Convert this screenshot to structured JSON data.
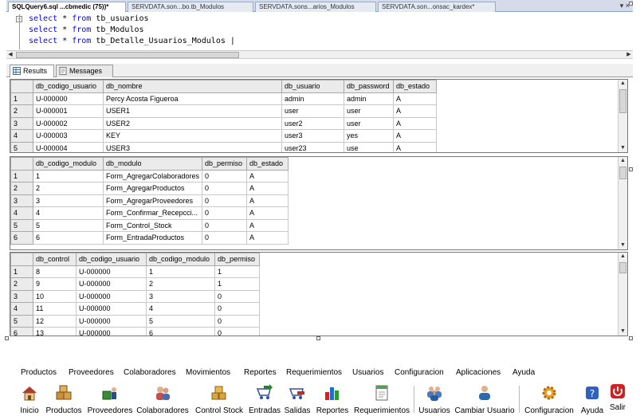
{
  "tabs": [
    {
      "label": "SQLQuery6.sql ...cbmedic (75))*",
      "active": true
    },
    {
      "label": "SERVDATA.son...bo.tb_Modulos",
      "active": false
    },
    {
      "label": "SERVDATA.sons...arios_Modulos",
      "active": false
    },
    {
      "label": "SERVDATA.son...onsac_kardex*",
      "active": false
    }
  ],
  "tab_menu": "▾ ×",
  "editor": {
    "lines": [
      {
        "kw1": "select",
        "mid": " * ",
        "kw2": "from",
        "rest": " tb_usuarios"
      },
      {
        "kw1": "select",
        "mid": " * ",
        "kw2": "from",
        "rest": " tb_Modulos"
      },
      {
        "kw1": "select",
        "mid": " * ",
        "kw2": "from",
        "rest": " tb_Detalle_Usuarios_Modulos |"
      }
    ]
  },
  "results_tabs": {
    "results": "Results",
    "messages": "Messages"
  },
  "grid1": {
    "columns": [
      "db_codigo_usuario",
      "db_nombre",
      "db_usuario",
      "db_password",
      "db_estado"
    ],
    "rows": [
      [
        "1",
        "U-000000",
        "Percy Acosta Figueroa",
        "admin",
        "admin",
        "A"
      ],
      [
        "2",
        "U-000001",
        "USER1",
        "user",
        "user",
        "A"
      ],
      [
        "3",
        "U-000002",
        "USER2",
        "user2",
        "user",
        "A"
      ],
      [
        "4",
        "U-000003",
        "KEY",
        "user3",
        "yes",
        "A"
      ],
      [
        "5",
        "U-000004",
        "USER3",
        "user23",
        "use",
        "A"
      ]
    ]
  },
  "grid2": {
    "columns": [
      "db_codigo_modulo",
      "db_modulo",
      "db_permiso",
      "db_estado"
    ],
    "rows": [
      [
        "1",
        "1",
        "Form_AgregarColaboradores",
        "0",
        "A"
      ],
      [
        "2",
        "2",
        "Form_AgregarProductos",
        "0",
        "A"
      ],
      [
        "3",
        "3",
        "Form_AgregarProveedores",
        "0",
        "A"
      ],
      [
        "4",
        "4",
        "Form_Confirmar_Recepcci...",
        "0",
        "A"
      ],
      [
        "5",
        "5",
        "Form_Control_Stock",
        "0",
        "A"
      ],
      [
        "6",
        "6",
        "Form_EntradaProductos",
        "0",
        "A"
      ]
    ]
  },
  "grid3": {
    "columns": [
      "db_control",
      "db_codigo_usuario",
      "db_codigo_modulo",
      "db_permiso"
    ],
    "rows": [
      [
        "1",
        "8",
        "U-000000",
        "1",
        "1"
      ],
      [
        "2",
        "9",
        "U-000000",
        "2",
        "1"
      ],
      [
        "3",
        "10",
        "U-000000",
        "3",
        "0"
      ],
      [
        "4",
        "11",
        "U-000000",
        "4",
        "0"
      ],
      [
        "5",
        "12",
        "U-000000",
        "5",
        "0"
      ],
      [
        "6",
        "13",
        "U-000000",
        "6",
        "0"
      ]
    ]
  },
  "menu": [
    "Productos",
    "Proveedores",
    "Colaboradores",
    "Movimientos",
    "Reportes",
    "Requerimientos",
    "Usuarios",
    "Configuracion",
    "Aplicaciones",
    "Ayuda"
  ],
  "toolbar": [
    {
      "label": "Inicio",
      "icon": "home-icon",
      "color": "#b23a2a"
    },
    {
      "label": "Productos",
      "icon": "boxes-icon",
      "color": "#c8903a"
    },
    {
      "label": "Proveedores",
      "icon": "supplier-icon",
      "color": "#3a8a3a"
    },
    {
      "label": "Colaboradores",
      "icon": "people-icon",
      "color": "#c0504d"
    },
    {
      "label": "Control Stock",
      "icon": "stock-icon",
      "color": "#d9a441"
    },
    {
      "label": "Entradas",
      "icon": "cart-in-icon",
      "color": "#2e7d32"
    },
    {
      "label": "Salidas",
      "icon": "cart-out-icon",
      "color": "#c62828"
    },
    {
      "label": "Reportes",
      "icon": "bar-chart-icon",
      "color": "#1e6fd1"
    },
    {
      "label": "Requerimientos",
      "icon": "document-icon",
      "color": "#5a9a5a"
    },
    {
      "label": "Usuarios",
      "icon": "users-icon",
      "color": "#4a7bbf"
    },
    {
      "label": "Cambiar Usuario",
      "icon": "user-switch-icon",
      "color": "#2a6ab0"
    },
    {
      "label": "Configuracion",
      "icon": "gear-icon",
      "color": "#f0a020"
    },
    {
      "label": "Ayuda",
      "icon": "help-icon",
      "color": "#3060c0"
    },
    {
      "label": "Salir",
      "icon": "power-icon",
      "color": "#d02020"
    }
  ]
}
